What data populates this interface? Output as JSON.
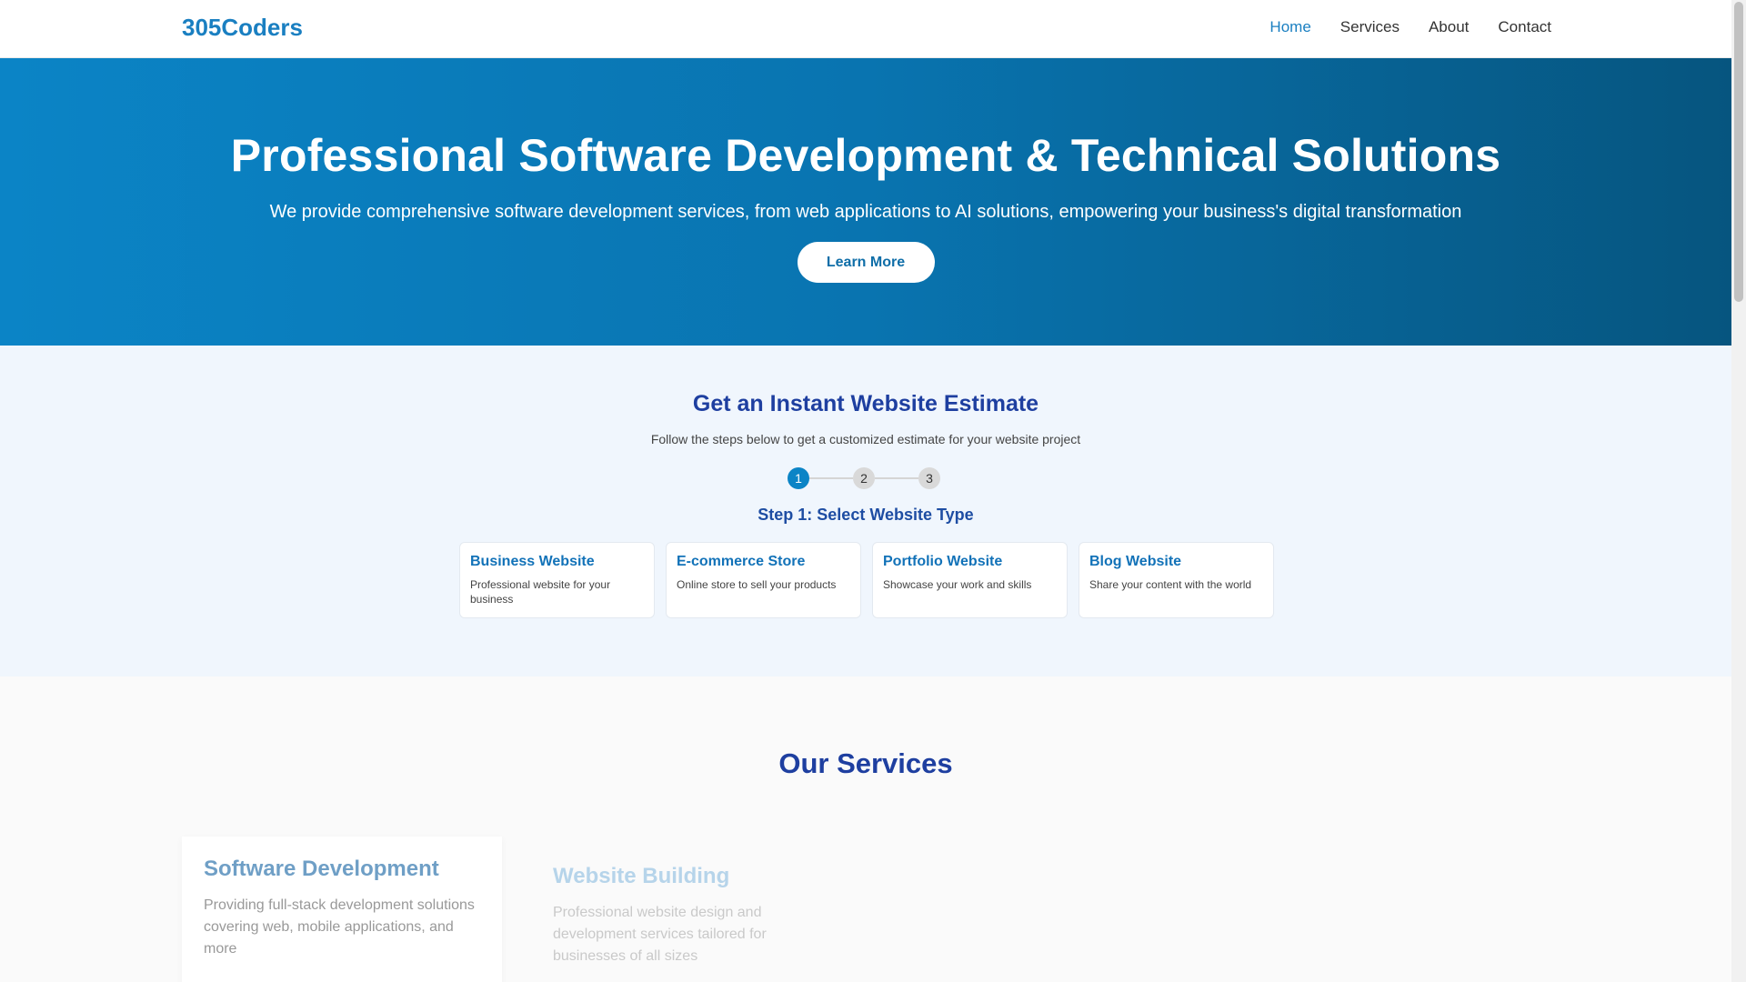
{
  "nav": {
    "logo": "305Coders",
    "links": [
      "Home",
      "Services",
      "About",
      "Contact"
    ],
    "active": "Home"
  },
  "hero": {
    "title": "Professional Software Development & Technical Solutions",
    "subtitle": "We provide comprehensive software development services, from web applications to AI solutions, empowering your business's digital transformation",
    "cta": "Learn More"
  },
  "estimate": {
    "title": "Get an Instant Website Estimate",
    "subtitle": "Follow the steps below to get a customized estimate for your website project",
    "steps": [
      "1",
      "2",
      "3"
    ],
    "current_step": 1,
    "step_title": "Step 1: Select Website Type",
    "types": [
      {
        "title": "Business Website",
        "desc": "Professional website for your business"
      },
      {
        "title": "E-commerce Store",
        "desc": "Online store to sell your products"
      },
      {
        "title": "Portfolio Website",
        "desc": "Showcase your work and skills"
      },
      {
        "title": "Blog Website",
        "desc": "Share your content with the world"
      }
    ]
  },
  "services": {
    "title": "Our Services",
    "items": [
      {
        "title": "Software Development",
        "desc": "Providing full-stack development solutions covering web, mobile applications, and more"
      },
      {
        "title": "Website Building",
        "desc": "Professional website design and development services tailored for businesses of all sizes"
      }
    ]
  },
  "colors": {
    "brand": "#1a7fc1",
    "heading": "#1e3fa0",
    "hero_start": "#0b84c6",
    "hero_end": "#06557f"
  }
}
